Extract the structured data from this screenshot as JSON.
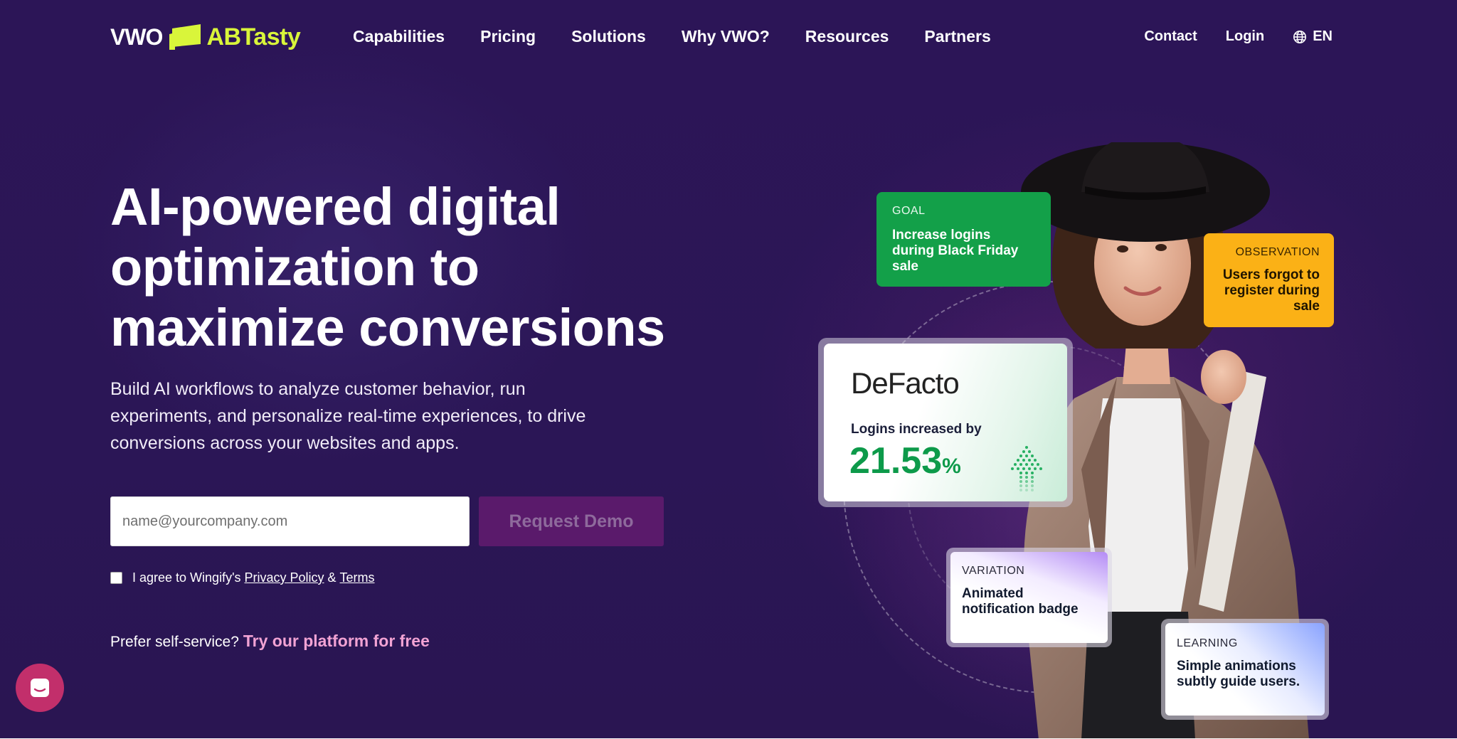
{
  "nav": {
    "logo_vwo": "VWO",
    "logo_ab": "ABTasty",
    "links": [
      "Capabilities",
      "Pricing",
      "Solutions",
      "Why VWO?",
      "Resources",
      "Partners"
    ],
    "contact": "Contact",
    "login": "Login",
    "language": "EN"
  },
  "hero": {
    "headline_line1": "AI-powered digital",
    "headline_line2": "optimization to",
    "headline_line3": "maximize conversions",
    "subtext": "Build AI workflows to analyze customer behavior, run experiments, and personalize real-time experiences, to drive conversions across your websites and apps.",
    "email_placeholder": "name@yourcompany.com",
    "demo_button": "Request Demo",
    "consent_prefix": "I agree to Wingify's",
    "privacy_link": "Privacy Policy",
    "consent_and": "&",
    "terms_link": "Terms",
    "selfservice_text": "Prefer self-service?",
    "selfservice_link": "Try our platform for free"
  },
  "cards": {
    "goal_label": "GOAL",
    "goal_text": "Increase logins during Black Friday sale",
    "observation_label": "OBSERVATION",
    "observation_text": "Users forgot to register during sale",
    "brand": "DeFacto",
    "metric_label": "Logins increased by",
    "metric_value": "21.53",
    "metric_unit": "%",
    "variation_label": "VARIATION",
    "variation_text": "Animated notification badge",
    "learning_label": "LEARNING",
    "learning_text": "Simple animations subtly guide users."
  },
  "colors": {
    "background": "#2b1656",
    "accent_lime": "#d9f53a",
    "goal_green": "#13a049",
    "observation_yellow": "#fbb116",
    "metric_green": "#0d9a4a",
    "demo_button": "#5a1a6b",
    "link_pink": "#f2a3d4",
    "chat_button": "#c22f6b"
  },
  "icons": [
    "globe-icon",
    "chat-icon",
    "arrow-up-dots-icon"
  ]
}
